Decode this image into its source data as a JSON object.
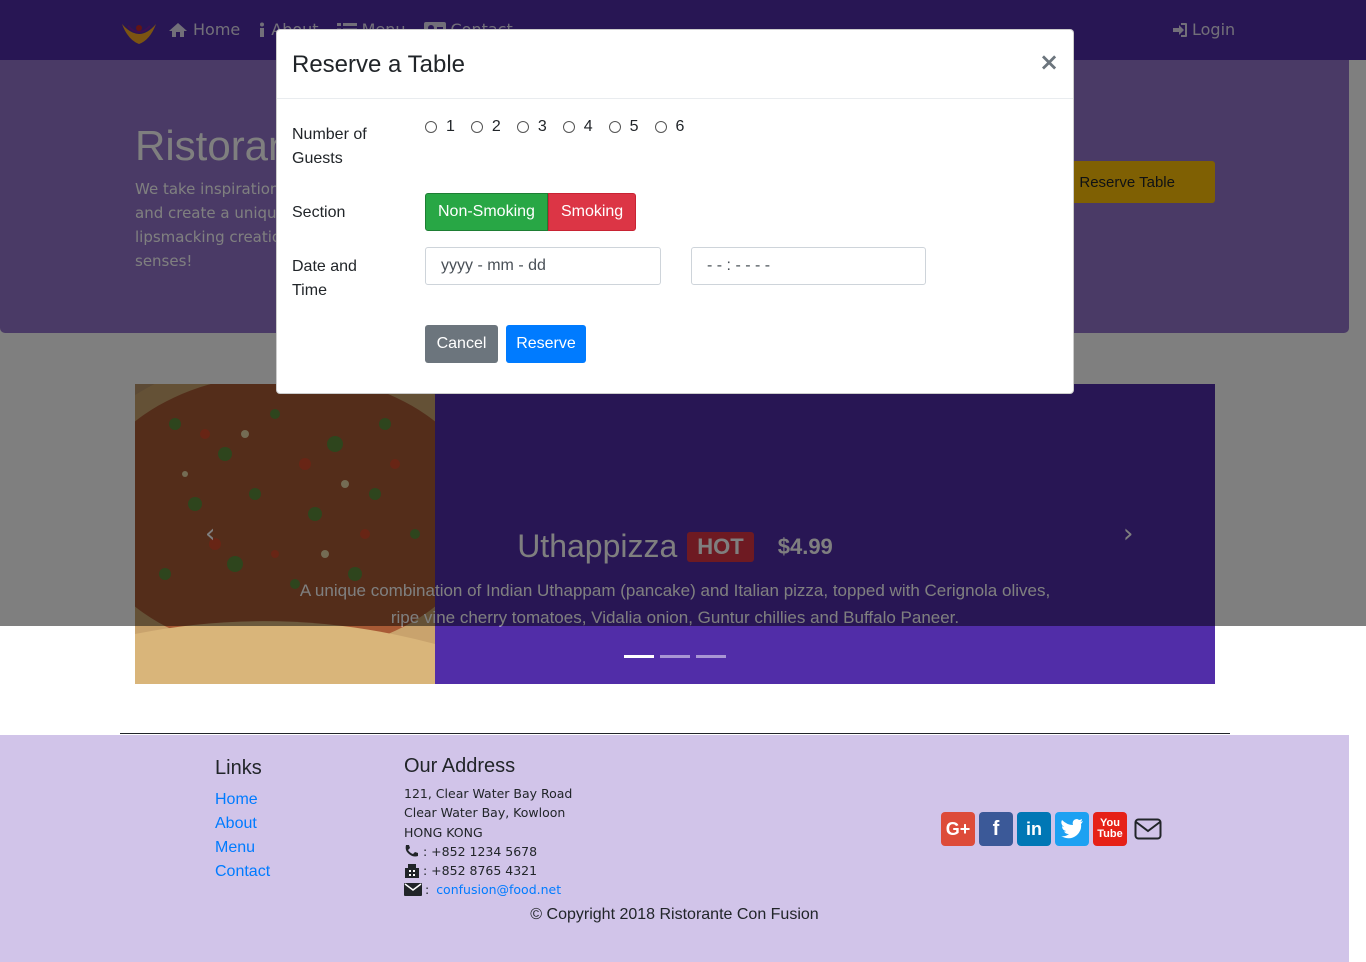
{
  "nav": {
    "items": [
      {
        "label": "Home",
        "icon": "home-icon"
      },
      {
        "label": "About",
        "icon": "info-icon"
      },
      {
        "label": "Menu",
        "icon": "list-icon"
      },
      {
        "label": "Contact",
        "icon": "address-card-icon"
      }
    ],
    "login": "Login"
  },
  "jumbotron": {
    "title": "Ristorante Con Fusion",
    "text": "We take inspiration from the World's best cuisines, and create a unique fusion experience. Our lipsmacking creations will tickle your culinary senses!",
    "reserve_button": "Reserve Table"
  },
  "carousel": {
    "title": "Uthappizza",
    "badge": "HOT",
    "price": "$4.99",
    "description": "A unique combination of Indian Uthappam (pancake) and Italian pizza, topped with Cerignola olives, ripe vine cherry tomatoes, Vidalia onion, Guntur chillies and Buffalo Paneer.",
    "prev": "‹",
    "next": "›"
  },
  "modal": {
    "title": "Reserve a Table",
    "close": "×",
    "guests_label": "Number of Guests",
    "guests_options": [
      "1",
      "2",
      "3",
      "4",
      "5",
      "6"
    ],
    "section_label": "Section",
    "section_options": [
      "Non-Smoking",
      "Smoking"
    ],
    "datetime_label": "Date and Time",
    "date_placeholder": "yyyy - mm - dd",
    "time_placeholder": "- - : - -   - -",
    "cancel": "Cancel",
    "reserve": "Reserve"
  },
  "footer": {
    "links_title": "Links",
    "links": [
      "Home",
      "About",
      "Menu",
      "Contact"
    ],
    "address_title": "Our Address",
    "address": [
      "121, Clear Water Bay Road",
      "Clear Water Bay, Kowloon",
      "HONG KONG"
    ],
    "phone": ": +852 1234 5678",
    "fax": ": +852 8765 4321",
    "email": "confusion@food.net",
    "copyright": "© Copyright 2018 Ristorante Con Fusion"
  },
  "colors": {
    "primary": "#512DA8",
    "jumbotron": "#9575CD",
    "footer": "#D1C4E9",
    "warning": "#FFC107",
    "success": "#28a745",
    "danger": "#dc3545",
    "link": "#007bff"
  }
}
